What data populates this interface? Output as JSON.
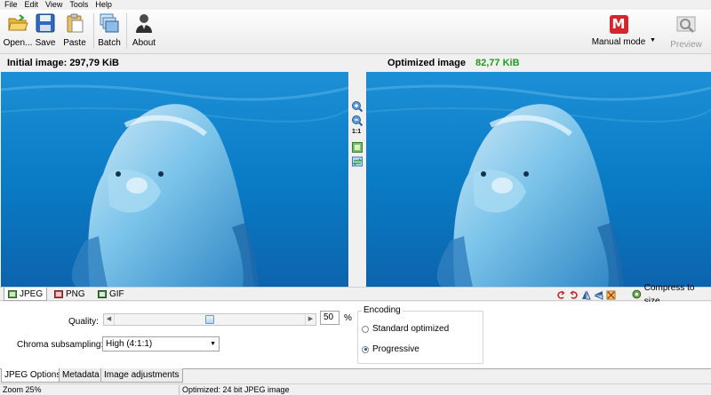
{
  "menu": [
    "File",
    "Edit",
    "View",
    "Tools",
    "Help"
  ],
  "toolbar": {
    "open": "Open...",
    "save": "Save",
    "paste": "Paste",
    "batch": "Batch",
    "about": "About",
    "mode_badge": "M",
    "mode_label": "Manual mode",
    "preview": "Preview"
  },
  "info": {
    "initial_label": "Initial image:",
    "initial_size": "297,79 KiB",
    "optimized_label": "Optimized image",
    "optimized_size": "82,77 KiB",
    "optimized_color": "#1f9a1f"
  },
  "viewer_tools": {
    "zoom_in": "zoom-in-icon",
    "zoom_out": "zoom-out-icon",
    "actual_size": "1:1",
    "fit": "fit-icon",
    "swap": "swap-icon"
  },
  "format_tabs": [
    "JPEG",
    "PNG",
    "GIF"
  ],
  "compress_label": "Compress to size",
  "options": {
    "quality_label": "Quality:",
    "quality_value": "50",
    "quality_fraction": 0.5,
    "quality_unit": "%",
    "chroma_label": "Chroma subsampling:",
    "chroma_value": "High (4:1:1)",
    "encoding_title": "Encoding",
    "encoding_options": [
      "Standard optimized",
      "Progressive"
    ],
    "encoding_selected": 1
  },
  "bottom_tabs": [
    "JPEG Options",
    "Metadata",
    "Image adjustments"
  ],
  "status": {
    "zoom": "Zoom 25%",
    "info": "Optimized: 24 bit JPEG image"
  },
  "colors": {
    "accent_red": "#d6262b",
    "water": "#0a79c4"
  }
}
